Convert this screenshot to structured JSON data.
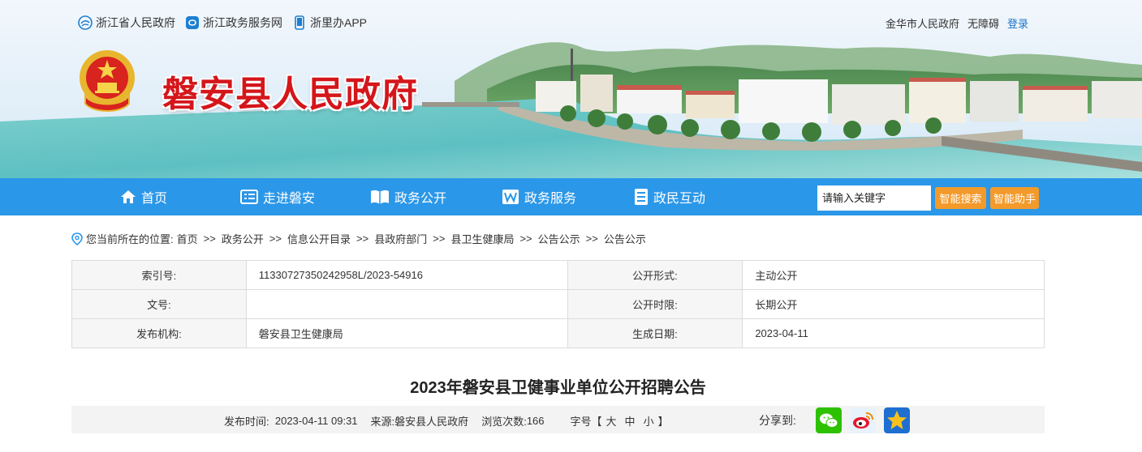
{
  "header": {
    "top_links": [
      {
        "label": "浙江省人民政府",
        "icon": "zhejiang-gov-icon"
      },
      {
        "label": "浙江政务服务网",
        "icon": "gov-service-icon"
      },
      {
        "label": "浙里办APP",
        "icon": "mobile-app-icon"
      }
    ],
    "right_links": {
      "city": "金华市人民政府",
      "accessibility": "无障碍",
      "login": "登录"
    },
    "site_title": "磐安县人民政府"
  },
  "nav": {
    "items": [
      {
        "label": "首页",
        "icon": "home-icon"
      },
      {
        "label": "走进磐安",
        "icon": "list-icon"
      },
      {
        "label": "政务公开",
        "icon": "book-icon"
      },
      {
        "label": "政务服务",
        "icon": "w-icon"
      },
      {
        "label": "政民互动",
        "icon": "document-icon"
      }
    ],
    "search_placeholder": "请输入关键字",
    "smart_search": "智能搜索",
    "smart_assistant": "智能助手"
  },
  "breadcrumb": {
    "prefix": "您当前所在的位置:",
    "items": [
      "首页",
      "政务公开",
      "信息公开目录",
      "县政府部门",
      "县卫生健康局",
      "公告公示",
      "公告公示"
    ],
    "separator": ">>"
  },
  "info_table": {
    "index_label": "索引号:",
    "index_value": "11330727350242958L/2023-54916",
    "open_form_label": "公开形式:",
    "open_form_value": "主动公开",
    "doc_no_label": "文号:",
    "doc_no_value": "",
    "open_period_label": "公开时限:",
    "open_period_value": "长期公开",
    "publisher_label": "发布机构:",
    "publisher_value": "磐安县卫生健康局",
    "date_label": "生成日期:",
    "date_value": "2023-04-11"
  },
  "article": {
    "title": "2023年磐安县卫健事业单位公开招聘公告"
  },
  "meta": {
    "publish_label": "发布时间:",
    "publish_time": "2023-04-11 09:31",
    "source_label": "来源:",
    "source": "磐安县人民政府",
    "views_label": "浏览次数:",
    "views": "166",
    "font_label": "字号【",
    "font_large": "大",
    "font_medium": "中",
    "font_small": "小",
    "font_end": "】",
    "share_label": "分享到:",
    "share_icons": [
      "wechat-icon",
      "weibo-icon",
      "qzone-icon"
    ]
  },
  "colors": {
    "nav_blue": "#2b97e8",
    "title_red": "#d4161b",
    "orange_button": "#f39a2b"
  }
}
